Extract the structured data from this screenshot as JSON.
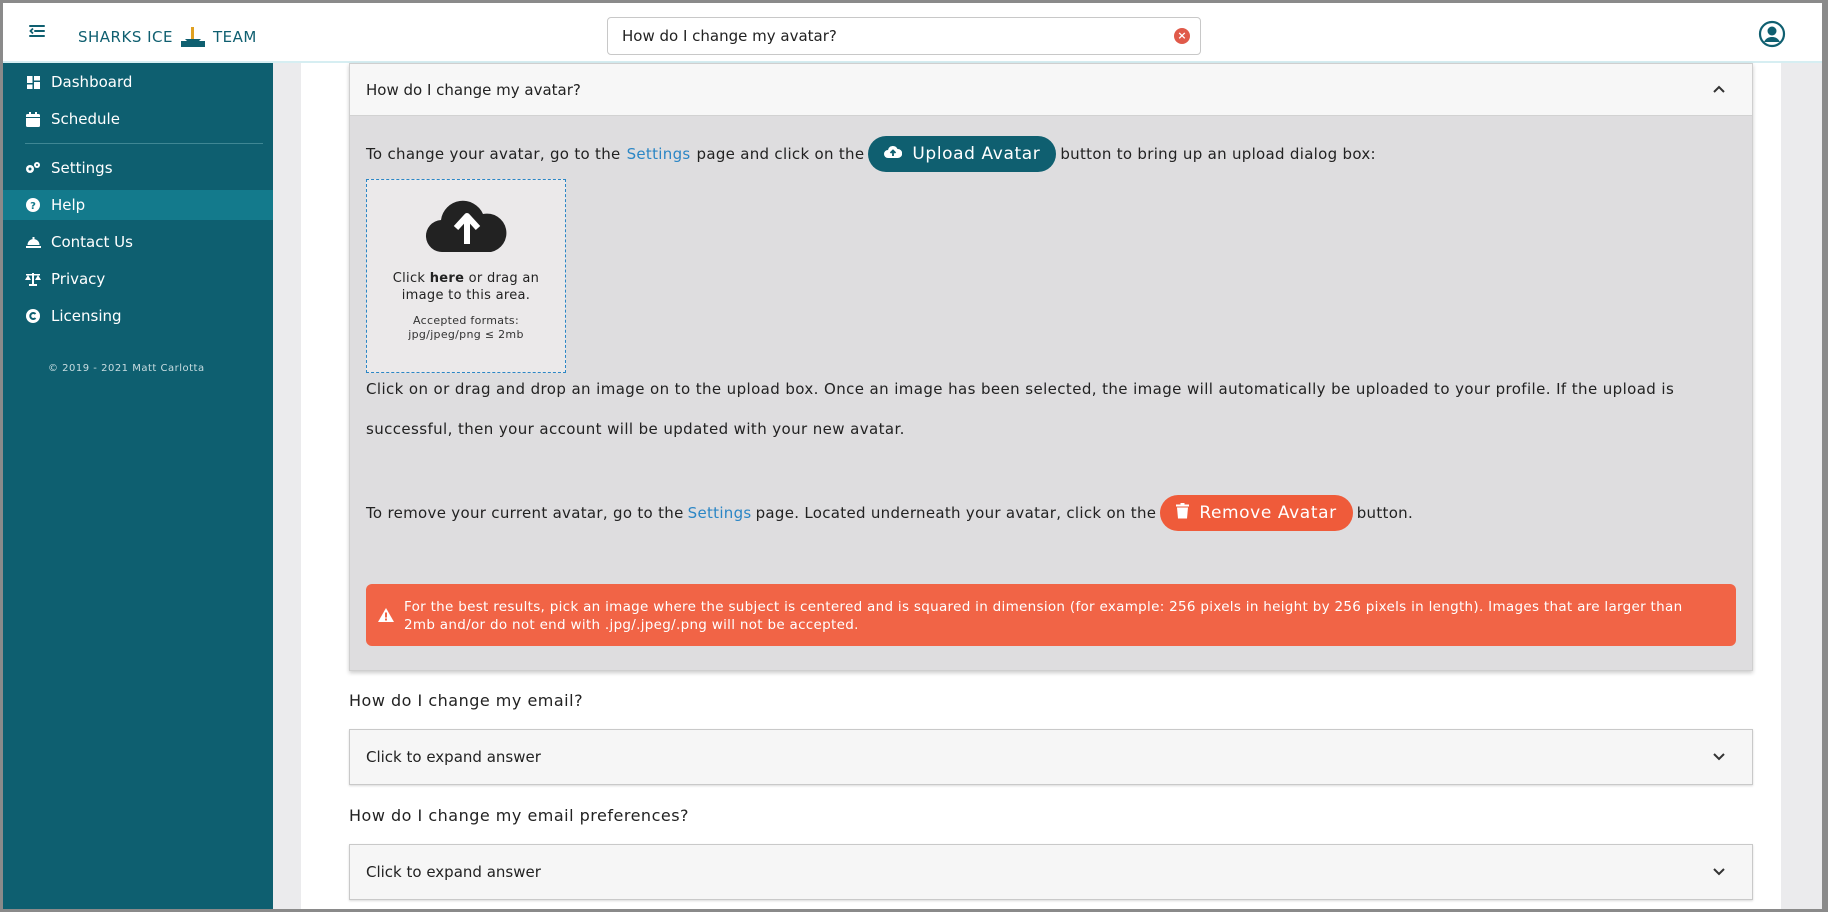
{
  "header": {
    "brand_left": "SHARKS ICE",
    "brand_right": "TEAM",
    "search_value": "How do I change my avatar?"
  },
  "sidebar": {
    "items": [
      {
        "label": "Dashboard",
        "icon": "grid-icon"
      },
      {
        "label": "Schedule",
        "icon": "calendar-icon"
      },
      {
        "label": "Settings",
        "icon": "gears-icon"
      },
      {
        "label": "Help",
        "icon": "question-circle-icon",
        "active": true
      },
      {
        "label": "Contact Us",
        "icon": "bell-concierge-icon"
      },
      {
        "label": "Privacy",
        "icon": "scale-icon"
      },
      {
        "label": "Licensing",
        "icon": "copyright-icon"
      }
    ],
    "copyright": "© 2019 - 2021 Matt Carlotta"
  },
  "faq": {
    "avatar": {
      "question": "How do I change my avatar?",
      "line1_pre": "To change your avatar, go to the",
      "settings_link": "Settings",
      "line1_mid": "page and click on the",
      "upload_button": "Upload Avatar",
      "line1_post": "button to bring up an upload dialog box:",
      "dropzone": {
        "click": "Click",
        "here": "here",
        "rest": "or drag an",
        "line2": "image to this area.",
        "formats_label": "Accepted formats:",
        "formats": "jpg/jpeg/png ≤ 2mb"
      },
      "paragraph": "Click on or drag and drop an image on to the upload box. Once an image has been selected, the image will automatically be uploaded to your profile. If the upload is successful, then your account will be updated with your new avatar.",
      "line3_pre": "To remove your current avatar, go to the",
      "line3_mid": "page. Located underneath your avatar, click on the",
      "remove_button": "Remove Avatar",
      "line3_post": "button.",
      "alert": "For the best results, pick an image where the subject is centered and is squared in dimension (for example: 256 pixels in height by 256 pixels in length). Images that are larger than 2mb and/or do not end with .jpg/.jpeg/.png will not be accepted."
    },
    "email": {
      "question": "How do I change my email?",
      "collapsed_label": "Click to expand answer"
    },
    "email_prefs": {
      "question": "How do I change my email preferences?",
      "collapsed_label": "Click to expand answer"
    }
  },
  "colors": {
    "brand": "#0e5f70",
    "link": "#2b86c5",
    "remove": "#ef5b3a",
    "alert": "#f16446"
  }
}
